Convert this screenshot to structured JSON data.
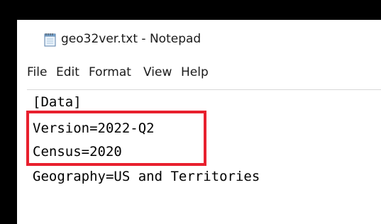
{
  "window": {
    "title": "geo32ver.txt - Notepad",
    "icon": "notepad-icon"
  },
  "menu": {
    "items": [
      {
        "label": "File"
      },
      {
        "label": "Edit"
      },
      {
        "label": "Format"
      },
      {
        "label": "View"
      },
      {
        "label": "Help"
      }
    ]
  },
  "document": {
    "lines": [
      "[Data]",
      "Version=2022-Q2",
      "Census=2020",
      "Geography=US and Territories"
    ]
  },
  "annotation": {
    "highlight_color": "#e8202e"
  }
}
